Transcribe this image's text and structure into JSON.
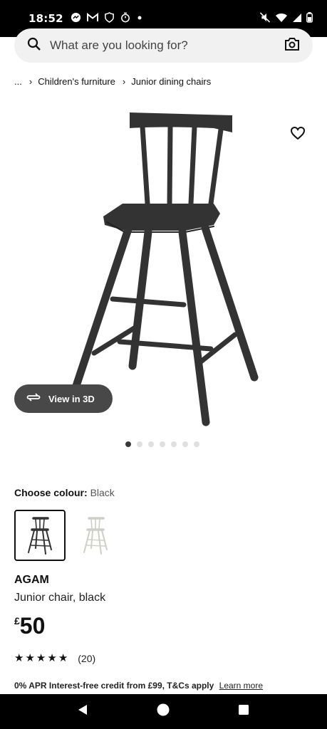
{
  "status_bar": {
    "time": "18:52",
    "left_icons": [
      "messenger-icon",
      "gmail-icon",
      "shield-icon",
      "timer-icon",
      "dot-icon"
    ],
    "right_icons": [
      "mute-icon",
      "wifi-icon",
      "signal-icon",
      "battery-icon"
    ]
  },
  "search": {
    "placeholder": "What are you looking for?",
    "icon": "search-icon",
    "camera_icon": "camera-icon"
  },
  "breadcrumb": {
    "ellipsis": "...",
    "items": [
      "Children's furniture",
      "Junior dining chairs"
    ]
  },
  "gallery": {
    "view3d_label": "View in 3D",
    "image_count": 7,
    "active_index": 0
  },
  "colour": {
    "label": "Choose colour:",
    "value": "Black",
    "options": [
      "Black",
      "White"
    ],
    "selected": 0
  },
  "product": {
    "name": "AGAM",
    "description": "Junior chair, black",
    "currency": "£",
    "price": "50"
  },
  "rating": {
    "stars": 5,
    "count": "(20)"
  },
  "credit": {
    "text": "0% APR Interest-free credit from £99, T&Cs apply",
    "link": "Learn more"
  },
  "colors": {
    "chair_black": "#333333",
    "view3d_bg": "#484848",
    "status_bg": "#000000"
  }
}
